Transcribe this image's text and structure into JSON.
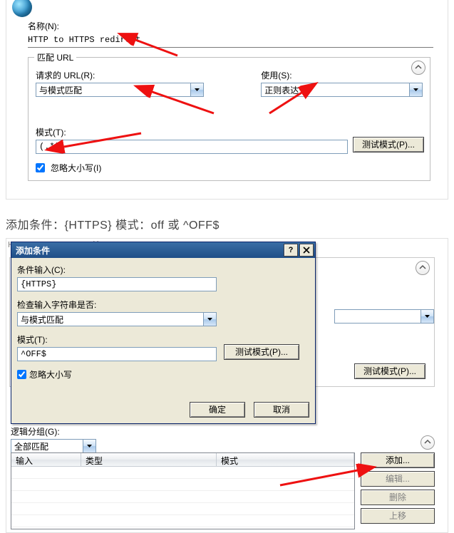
{
  "panel1": {
    "name_label": "名称(N):",
    "name_value": "HTTP to HTTPS redirect",
    "match_url_legend": "匹配 URL",
    "requested_url_label": "请求的 URL(R):",
    "requested_url_value": "与模式匹配",
    "use_label": "使用(S):",
    "use_value": "正则表达式",
    "pattern_label": "模式(T):",
    "pattern_value": "(.*)",
    "test_pattern_btn": "测试模式(P)...",
    "ignore_case_label": "忽略大小写(I)"
  },
  "caption": "添加条件：{HTTPS} 模式：off 或 ^OFF$",
  "panel2": {
    "title_bg_text": "HTTP to HTTPS redirect",
    "bg_select_value": "",
    "bg_test_btn": "测试模式(P)...",
    "logic_group_label": "逻辑分组(G):",
    "logic_group_value": "全部匹配",
    "table": {
      "cols": [
        "输入",
        "类型",
        "模式"
      ],
      "rows": []
    },
    "side_buttons": {
      "add": "添加...",
      "edit": "编辑...",
      "delete": "删除",
      "move_up": "上移"
    }
  },
  "dialog": {
    "title": "添加条件",
    "cond_input_label": "条件输入(C):",
    "cond_input_value": "{HTTPS}",
    "check_label": "检查输入字符串是否:",
    "check_value": "与模式匹配",
    "pattern_label": "模式(T):",
    "pattern_value": "^OFF$",
    "test_pattern_btn": "测试模式(P)...",
    "ignore_case_label": "忽略大小写",
    "ok": "确定",
    "cancel": "取消"
  }
}
